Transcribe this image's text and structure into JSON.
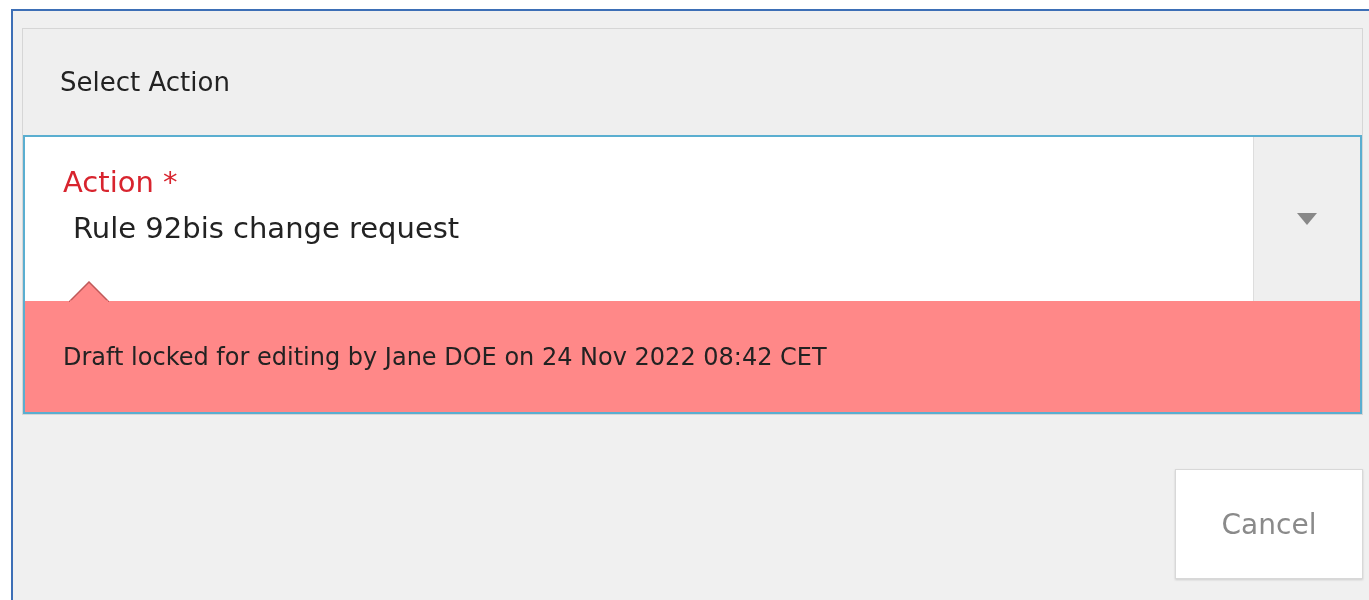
{
  "dialog": {
    "title": "Select Action",
    "field": {
      "label": "Action *",
      "value": "Rule 92bis change request"
    },
    "error": "Draft locked for editing by Jane DOE on 24 Nov 2022 08:42 CET",
    "buttons": [
      "Cancel"
    ]
  }
}
